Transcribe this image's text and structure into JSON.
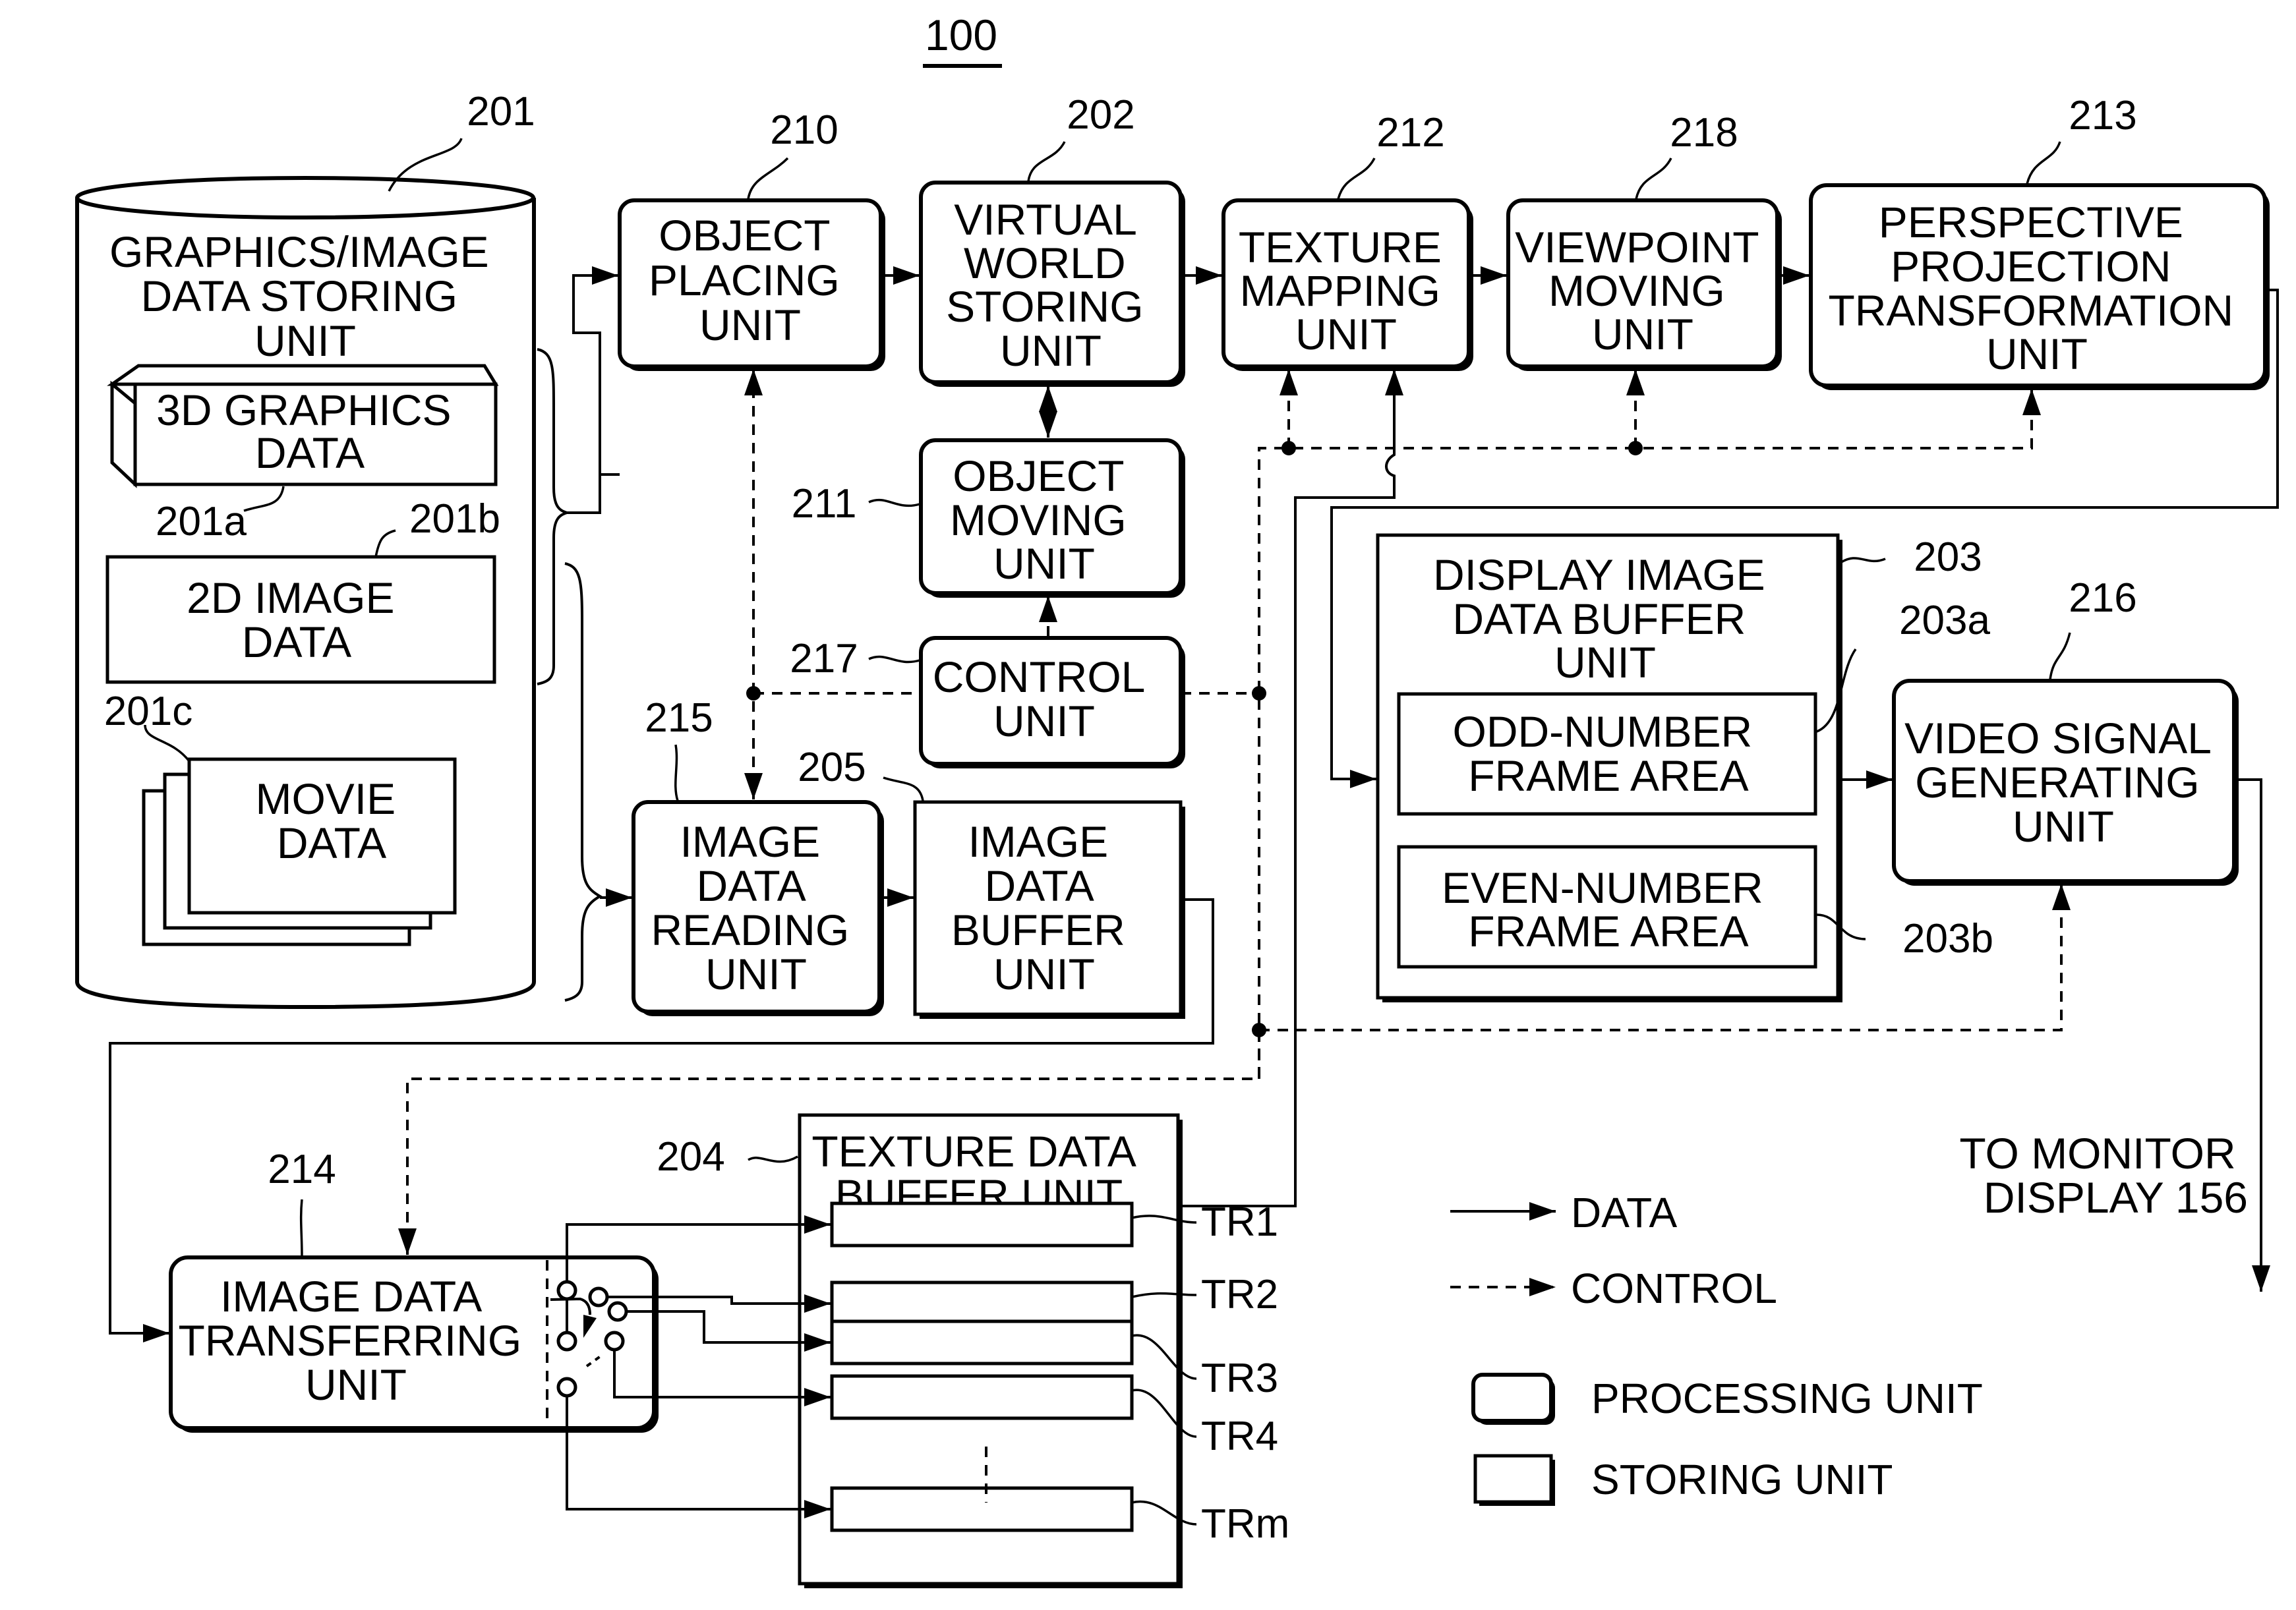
{
  "figure": {
    "number": "100"
  },
  "blocks": {
    "graphics_store": {
      "ref": "201",
      "label": [
        "GRAPHICS/IMAGE",
        "DATA STORING",
        "UNIT"
      ],
      "kind": "storing"
    },
    "graphics_3d": {
      "ref": "201a",
      "label": [
        "3D GRAPHICS",
        "DATA"
      ],
      "kind": "storing"
    },
    "image_2d": {
      "ref": "201b",
      "label": [
        "2D IMAGE",
        "DATA"
      ],
      "kind": "storing"
    },
    "movie": {
      "ref": "201c",
      "label": [
        "MOVIE",
        "DATA"
      ],
      "kind": "storing"
    },
    "object_placing": {
      "ref": "210",
      "label": [
        "OBJECT",
        "PLACING",
        "UNIT"
      ],
      "kind": "processing"
    },
    "virtual_world": {
      "ref": "202",
      "label": [
        "VIRTUAL",
        "WORLD",
        "STORING",
        "UNIT"
      ],
      "kind": "processing"
    },
    "texture_mapping": {
      "ref": "212",
      "label": [
        "TEXTURE",
        "MAPPING",
        "UNIT"
      ],
      "kind": "processing"
    },
    "viewpoint_moving": {
      "ref": "218",
      "label": [
        "VIEWPOINT",
        "MOVING",
        "UNIT"
      ],
      "kind": "processing"
    },
    "perspective": {
      "ref": "213",
      "label": [
        "PERSPECTIVE",
        "PROJECTION",
        "TRANSFORMATION",
        "UNIT"
      ],
      "kind": "processing"
    },
    "object_moving": {
      "ref": "211",
      "label": [
        "OBJECT",
        "MOVING",
        "UNIT"
      ],
      "kind": "processing"
    },
    "control": {
      "ref": "217",
      "label": [
        "CONTROL",
        "UNIT"
      ],
      "kind": "processing"
    },
    "image_reading": {
      "ref": "215",
      "label": [
        "IMAGE",
        "DATA",
        "READING",
        "UNIT"
      ],
      "kind": "processing"
    },
    "image_buffer": {
      "ref": "205",
      "label": [
        "IMAGE",
        "DATA",
        "BUFFER",
        "UNIT"
      ],
      "kind": "storing"
    },
    "display_buffer": {
      "ref": "203",
      "label": [
        "DISPLAY IMAGE",
        "DATA BUFFER",
        "UNIT"
      ],
      "kind": "storing"
    },
    "odd_frame": {
      "ref": "203a",
      "label": [
        "ODD-NUMBER",
        "FRAME AREA"
      ],
      "kind": "storing"
    },
    "even_frame": {
      "ref": "203b",
      "label": [
        "EVEN-NUMBER",
        "FRAME AREA"
      ],
      "kind": "storing"
    },
    "video_signal": {
      "ref": "216",
      "label": [
        "VIDEO SIGNAL",
        "GENERATING",
        "UNIT"
      ],
      "kind": "processing"
    },
    "image_transfer": {
      "ref": "214",
      "label": [
        "IMAGE DATA",
        "TRANSFERRING",
        "UNIT"
      ],
      "kind": "processing"
    },
    "texture_buffer": {
      "ref": "204",
      "label": [
        "TEXTURE DATA",
        "BUFFER UNIT"
      ],
      "kind": "storing"
    }
  },
  "texture_slots": [
    "TR1",
    "TR2",
    "TR3",
    "TR4",
    "TRm"
  ],
  "output": {
    "label": [
      "TO MONITOR",
      "DISPLAY 156"
    ]
  },
  "legend": {
    "data": "DATA",
    "control": "CONTROL",
    "processing": "PROCESSING UNIT",
    "storing": "STORING UNIT"
  }
}
